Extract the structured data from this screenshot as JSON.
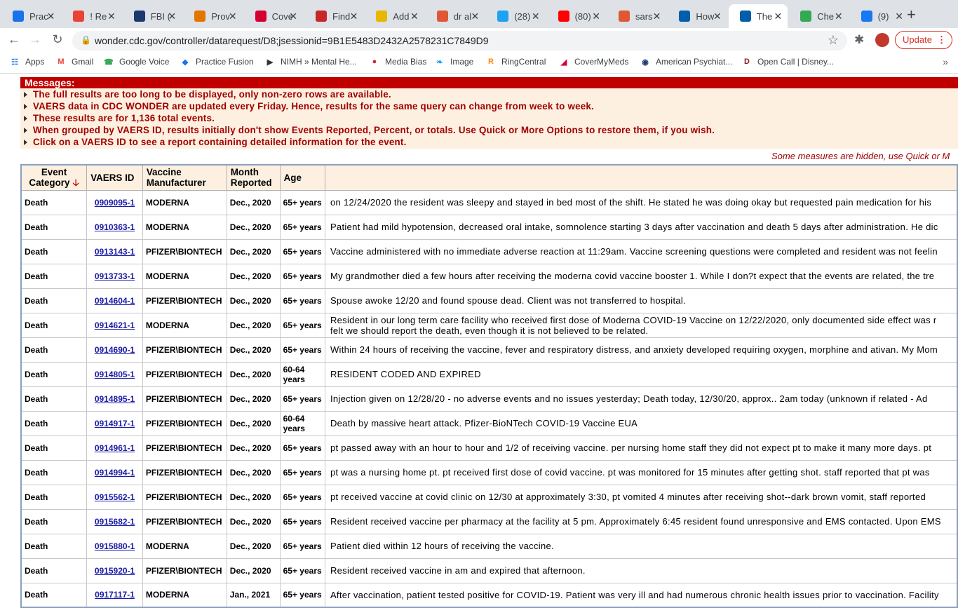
{
  "tabs": [
    {
      "title": "Prac",
      "icon": "grid-icon",
      "color": "#1a73e8"
    },
    {
      "title": "! Re",
      "icon": "gmail-icon",
      "color": "#ea4335"
    },
    {
      "title": "FBI (",
      "icon": "et-icon",
      "color": "#1b3a6b"
    },
    {
      "title": "Prov",
      "icon": "prov-icon",
      "color": "#e37400"
    },
    {
      "title": "Cove",
      "icon": "covermymeds-icon",
      "color": "#d50032"
    },
    {
      "title": "Find",
      "icon": "find-icon",
      "color": "#c62828"
    },
    {
      "title": "Add",
      "icon": "add-icon",
      "color": "#e6b800"
    },
    {
      "title": "dr al",
      "icon": "duckduckgo-icon",
      "color": "#de5833"
    },
    {
      "title": "(28)",
      "icon": "twitter-icon",
      "color": "#1da1f2"
    },
    {
      "title": "(80)",
      "icon": "youtube-icon",
      "color": "#ff0000"
    },
    {
      "title": "sars",
      "icon": "duckduckgo-icon",
      "color": "#de5833"
    },
    {
      "title": "How",
      "icon": "cdc-icon",
      "color": "#005eaa"
    },
    {
      "title": "The",
      "icon": "cdc-icon",
      "color": "#005eaa",
      "active": true
    },
    {
      "title": "Che",
      "icon": "check-icon",
      "color": "#34a853"
    },
    {
      "title": "(9)",
      "icon": "facebook-icon",
      "color": "#1877f2"
    }
  ],
  "toolbar": {
    "url": "wonder.cdc.gov/controller/datarequest/D8;jsessionid=9B1E5483D2432A2578231C7849D9",
    "update_label": "Update"
  },
  "bookmarks": [
    {
      "label": "Apps",
      "icon": "apps-icon"
    },
    {
      "label": "Gmail",
      "icon": "gmail-icon"
    },
    {
      "label": "Google Voice",
      "icon": "phone-icon"
    },
    {
      "label": "Practice Fusion",
      "icon": "practice-fusion-icon"
    },
    {
      "label": "NIMH » Mental He...",
      "icon": "nimh-icon"
    },
    {
      "label": "Media Bias",
      "icon": "media-bias-icon"
    },
    {
      "label": "Image",
      "icon": "twitter-icon"
    },
    {
      "label": "RingCentral",
      "icon": "ringcentral-icon"
    },
    {
      "label": "CoverMyMeds",
      "icon": "covermymeds-icon"
    },
    {
      "label": "American Psychiat...",
      "icon": "apa-icon"
    },
    {
      "label": "Open Call | Disney...",
      "icon": "disney-icon"
    }
  ],
  "messages": {
    "header": "Messages:",
    "items": [
      "The full results are too long to be displayed, only non-zero rows are available.",
      "VAERS data in CDC WONDER are updated every Friday. Hence, results for the same query can change from week to week.",
      "These results are for 1,136 total events.",
      "When grouped by VAERS ID, results initially don't show Events Reported, Percent, or totals. Use Quick or More Options to restore them, if you wish.",
      "Click on a VAERS ID to see a report containing detailed information for the event."
    ],
    "hidden_note": "Some measures are hidden, use Quick or M"
  },
  "table": {
    "headers": {
      "category": "Event Category",
      "vaers_id": "VAERS ID",
      "manufacturer": "Vaccine Manufacturer",
      "month": "Month Reported",
      "age": "Age",
      "description": ""
    },
    "rows": [
      {
        "category": "Death",
        "id": "0909095-1",
        "mfr": "MODERNA",
        "month": "Dec., 2020",
        "age": "65+ years",
        "desc": [
          "on 12/24/2020 the resident was sleepy and stayed in bed most of the shift. He stated he was doing okay but requested pain medication for his"
        ]
      },
      {
        "category": "Death",
        "id": "0910363-1",
        "mfr": "MODERNA",
        "month": "Dec., 2020",
        "age": "65+ years",
        "desc": [
          "Patient had mild hypotension, decreased oral intake, somnolence starting 3 days after vaccination and death 5 days after administration. He dic"
        ]
      },
      {
        "category": "Death",
        "id": "0913143-1",
        "mfr": "PFIZER\\BIONTECH",
        "month": "Dec., 2020",
        "age": "65+ years",
        "desc": [
          "Vaccine administered with no immediate adverse reaction at 11:29am. Vaccine screening questions were completed and resident was not feelin"
        ]
      },
      {
        "category": "Death",
        "id": "0913733-1",
        "mfr": "MODERNA",
        "month": "Dec., 2020",
        "age": "65+ years",
        "desc": [
          "My grandmother died a few hours after receiving the moderna covid vaccine booster 1. While I don?t expect that the events are related, the tre"
        ]
      },
      {
        "category": "Death",
        "id": "0914604-1",
        "mfr": "PFIZER\\BIONTECH",
        "month": "Dec., 2020",
        "age": "65+ years",
        "desc": [
          "Spouse awoke 12/20 and found spouse dead. Client was not transferred to hospital."
        ]
      },
      {
        "category": "Death",
        "id": "0914621-1",
        "mfr": "MODERNA",
        "month": "Dec., 2020",
        "age": "65+ years",
        "desc": [
          "Resident in our long term care facility who received first dose of Moderna COVID-19 Vaccine on 12/22/2020, only documented side effect was r",
          "felt we should report the death, even though it is not believed to be related."
        ]
      },
      {
        "category": "Death",
        "id": "0914690-1",
        "mfr": "PFIZER\\BIONTECH",
        "month": "Dec., 2020",
        "age": "65+ years",
        "desc": [
          "Within 24 hours of receiving the vaccine, fever and respiratory distress, and anxiety developed requiring oxygen, morphine and ativan. My Mom"
        ]
      },
      {
        "category": "Death",
        "id": "0914805-1",
        "mfr": "PFIZER\\BIONTECH",
        "month": "Dec., 2020",
        "age": "60-64 years",
        "desc": [
          "RESIDENT CODED AND EXPIRED"
        ]
      },
      {
        "category": "Death",
        "id": "0914895-1",
        "mfr": "PFIZER\\BIONTECH",
        "month": "Dec., 2020",
        "age": "65+ years",
        "desc": [
          "Injection given on 12/28/20 - no adverse events and no issues yesterday; Death today, 12/30/20, approx.. 2am today (unknown if related - Ad"
        ]
      },
      {
        "category": "Death",
        "id": "0914917-1",
        "mfr": "PFIZER\\BIONTECH",
        "month": "Dec., 2020",
        "age": "60-64 years",
        "desc": [
          "Death by massive heart attack. Pfizer-BioNTech COVID-19 Vaccine EUA"
        ]
      },
      {
        "category": "Death",
        "id": "0914961-1",
        "mfr": "PFIZER\\BIONTECH",
        "month": "Dec., 2020",
        "age": "65+ years",
        "desc": [
          "pt passed away with an hour to hour and 1/2 of receiving vaccine. per nursing home staff they did not expect pt to make it many more days. pt"
        ]
      },
      {
        "category": "Death",
        "id": "0914994-1",
        "mfr": "PFIZER\\BIONTECH",
        "month": "Dec., 2020",
        "age": "65+ years",
        "desc": [
          "pt was a nursing home pt. pt received first dose of covid vaccine. pt was monitored for 15 minutes after getting shot. staff reported that pt was"
        ]
      },
      {
        "category": "Death",
        "id": "0915562-1",
        "mfr": "PFIZER\\BIONTECH",
        "month": "Dec., 2020",
        "age": "65+ years",
        "desc": [
          "pt received vaccine at covid clinic on 12/30 at approximately 3:30, pt vomited 4 minutes after receiving shot--dark brown vomit, staff reported"
        ]
      },
      {
        "category": "Death",
        "id": "0915682-1",
        "mfr": "PFIZER\\BIONTECH",
        "month": "Dec., 2020",
        "age": "65+ years",
        "desc": [
          "Resident received vaccine per pharmacy at the facility at 5 pm. Approximately 6:45 resident found unresponsive and EMS contacted. Upon EMS"
        ]
      },
      {
        "category": "Death",
        "id": "0915880-1",
        "mfr": "MODERNA",
        "month": "Dec., 2020",
        "age": "65+ years",
        "desc": [
          "Patient died within 12 hours of receiving the vaccine."
        ]
      },
      {
        "category": "Death",
        "id": "0915920-1",
        "mfr": "PFIZER\\BIONTECH",
        "month": "Dec., 2020",
        "age": "65+ years",
        "desc": [
          "Resident received vaccine in am and expired that afternoon."
        ]
      },
      {
        "category": "Death",
        "id": "0917117-1",
        "mfr": "MODERNA",
        "month": "Jan., 2021",
        "age": "65+ years",
        "desc": [
          "After vaccination, patient tested positive for COVID-19. Patient was very ill and had numerous chronic health issues prior to vaccination. Facility"
        ]
      }
    ]
  }
}
